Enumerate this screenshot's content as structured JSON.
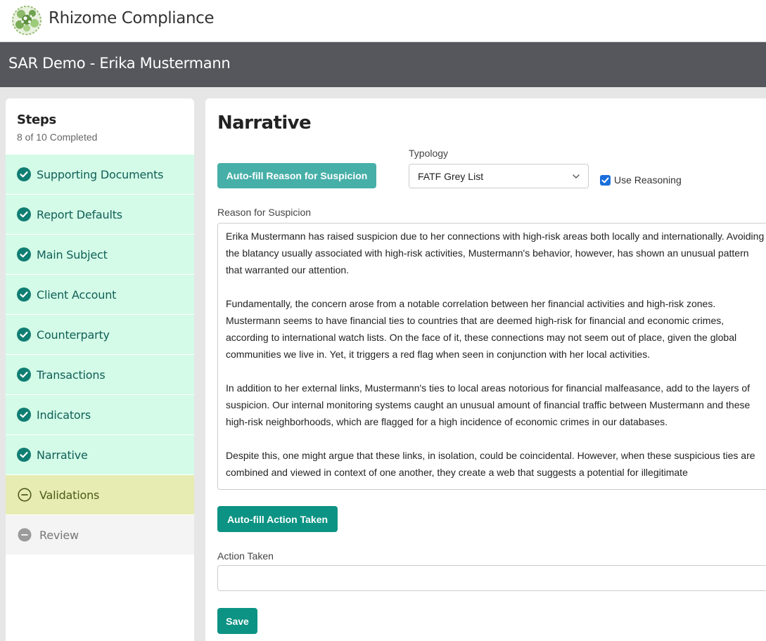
{
  "app": {
    "brand": "Rhizome Compliance",
    "page_title": "SAR Demo - Erika Mustermann"
  },
  "sidebar": {
    "title": "Steps",
    "progress": "8 of 10 Completed",
    "items": [
      {
        "label": "Supporting Documents",
        "status": "done"
      },
      {
        "label": "Report Defaults",
        "status": "done"
      },
      {
        "label": "Main Subject",
        "status": "done"
      },
      {
        "label": "Client Account",
        "status": "done"
      },
      {
        "label": "Counterparty",
        "status": "done"
      },
      {
        "label": "Transactions",
        "status": "done"
      },
      {
        "label": "Indicators",
        "status": "done"
      },
      {
        "label": "Narrative",
        "status": "done"
      },
      {
        "label": "Validations",
        "status": "active"
      },
      {
        "label": "Review",
        "status": "todo"
      }
    ]
  },
  "main": {
    "heading": "Narrative",
    "autofill_reason_label": "Auto-fill Reason for Suspicion",
    "typology_label": "Typology",
    "typology_value": "FATF Grey List",
    "use_reasoning_label": "Use Reasoning",
    "use_reasoning_checked": true,
    "reason_label": "Reason for Suspicion",
    "reason_paragraphs": [
      "Erika Mustermann has raised suspicion due to her connections with high-risk areas both locally and internationally. Avoiding the blatancy usually associated with high-risk activities, Mustermann's behavior, however, has shown an unusual pattern that warranted our attention.",
      "Fundamentally, the concern arose from a notable correlation between her financial activities and high-risk zones. Mustermann seems to have financial ties to countries that are deemed high-risk for financial and economic crimes, according to international watch lists. On the face of it, these connections may not seem out of place, given the global communities we live in. Yet, it triggers a red flag when seen in conjunction with her local activities.",
      "In addition to her external links, Mustermann's ties to local areas notorious for financial malfeasance, add to the layers of suspicion. Our internal monitoring systems caught an unusual amount of financial traffic between Mustermann and these high-risk neighborhoods, which are flagged for a high incidence of economic crimes in our databases.",
      "Despite this, one might argue that these links, in isolation, could be coincidental. However, when these suspicious ties are combined and viewed in context of one another, they create a web that suggests a potential for illegitimate"
    ],
    "autofill_action_label": "Auto-fill Action Taken",
    "action_label": "Action Taken",
    "action_value": "",
    "save_label": "Save"
  },
  "colors": {
    "accent": "#0c9383",
    "accent_light": "#46afa8",
    "step_done_bg": "#d4fbe8",
    "step_active_bg": "#e6ecb2",
    "titlebar_bg": "#55575d"
  }
}
